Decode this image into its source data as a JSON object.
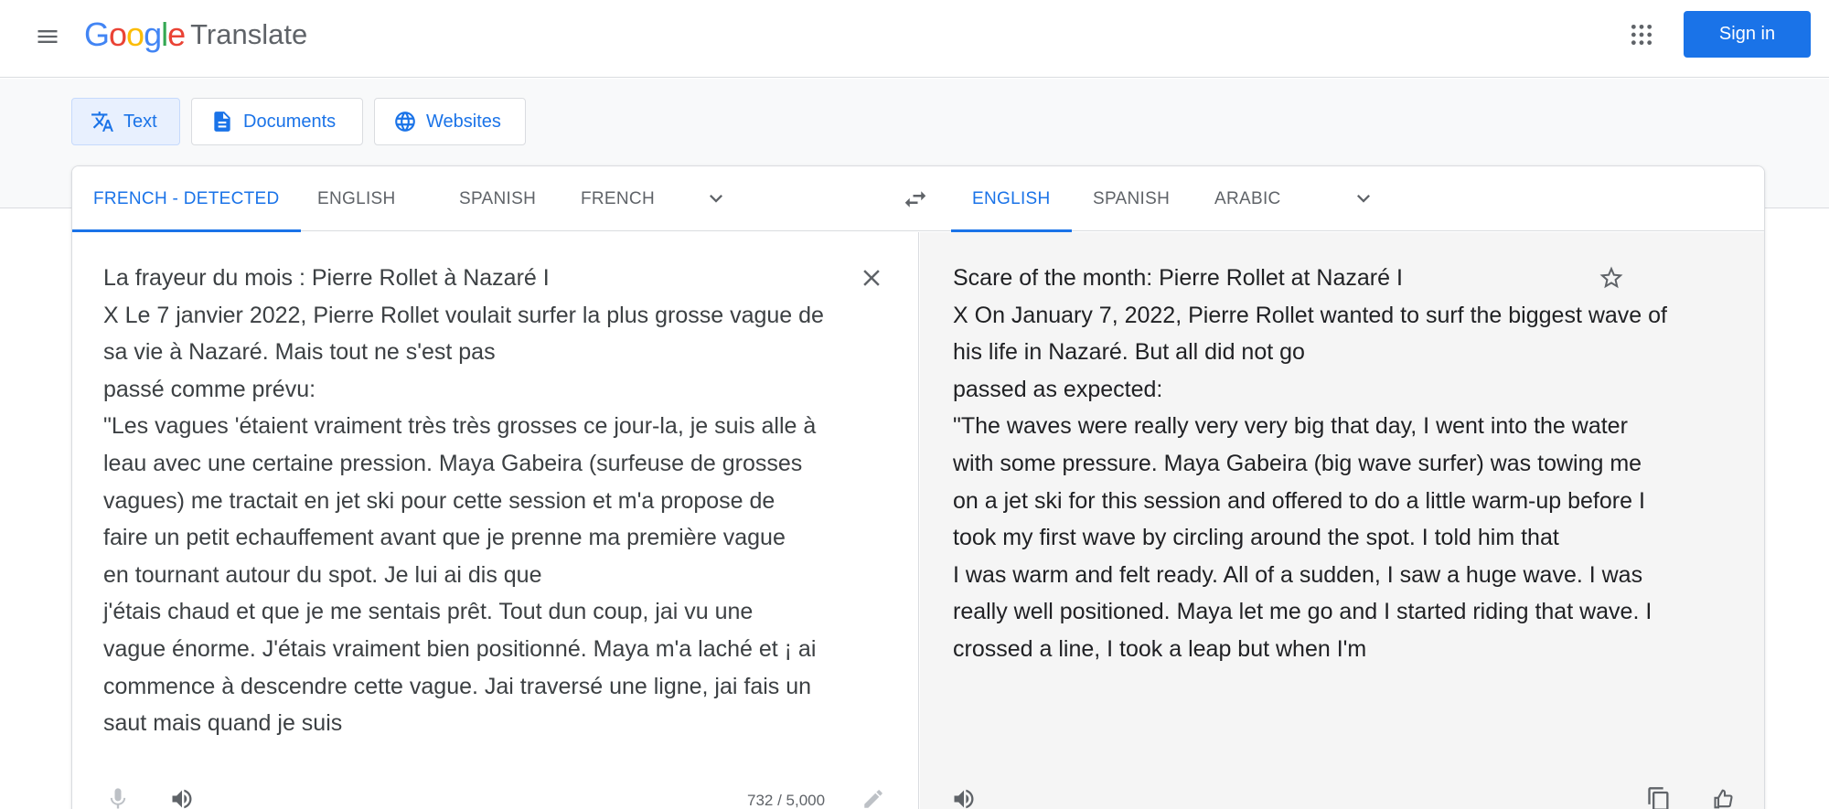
{
  "header": {
    "logo_google": "Google",
    "logo_product": "Translate",
    "signin_label": "Sign in"
  },
  "modes": {
    "text": "Text",
    "documents": "Documents",
    "websites": "Websites"
  },
  "source_langs": [
    "FRENCH - DETECTED",
    "ENGLISH",
    "SPANISH",
    "FRENCH"
  ],
  "target_langs": [
    "ENGLISH",
    "SPANISH",
    "ARABIC"
  ],
  "source_text": [
    "La frayeur du mois : Pierre Rollet à Nazaré I",
    "X Le 7 janvier 2022, Pierre Rollet voulait surfer la plus grosse vague de",
    "sa vie à Nazaré. Mais tout ne s'est pas",
    "passé comme prévu:",
    "\"Les vagues 'étaient vraiment très très grosses ce jour-la, je suis alle à",
    "leau avec une certaine pression. Maya Gabeira (surfeuse de grosses",
    "vagues) me tractait en jet ski pour cette session et m'a propose de",
    "faire un petit echauffement avant que je prenne ma première vague",
    "en tournant autour du spot. Je lui ai dis que",
    "j'étais chaud et que je me sentais prêt. Tout dun coup, jai vu une",
    "vague énorme. J'étais vraiment bien positionné. Maya m'a laché et ¡ ai",
    "commence à descendre cette vague. Jai traversé une ligne, jai fais un",
    "saut mais quand je suis"
  ],
  "target_text": [
    "Scare of the month: Pierre Rollet at Nazaré I",
    "X On January 7, 2022, Pierre Rollet wanted to surf the biggest wave of",
    "his life in Nazaré. But all did not go",
    "passed as expected:",
    "\"The waves were really very very big that day, I went into the water",
    "with some pressure. Maya Gabeira (big wave surfer) was towing me",
    "on a jet ski for this session and offered to do a little warm-up before I",
    "took my first wave by circling around the spot. I told him that",
    "I was warm and felt ready. All of a sudden, I saw a huge wave. I was",
    "really well positioned. Maya let me go and I started riding that wave. I",
    "crossed a line, I took a leap but when I'm"
  ],
  "char_count": "732 / 5,000",
  "colors": {
    "accent": "#1a73e8",
    "icon_gray": "#5f6368",
    "google_blue": "#4285f4",
    "google_red": "#ea4335",
    "google_yellow": "#fbbc05",
    "google_green": "#34a853"
  }
}
